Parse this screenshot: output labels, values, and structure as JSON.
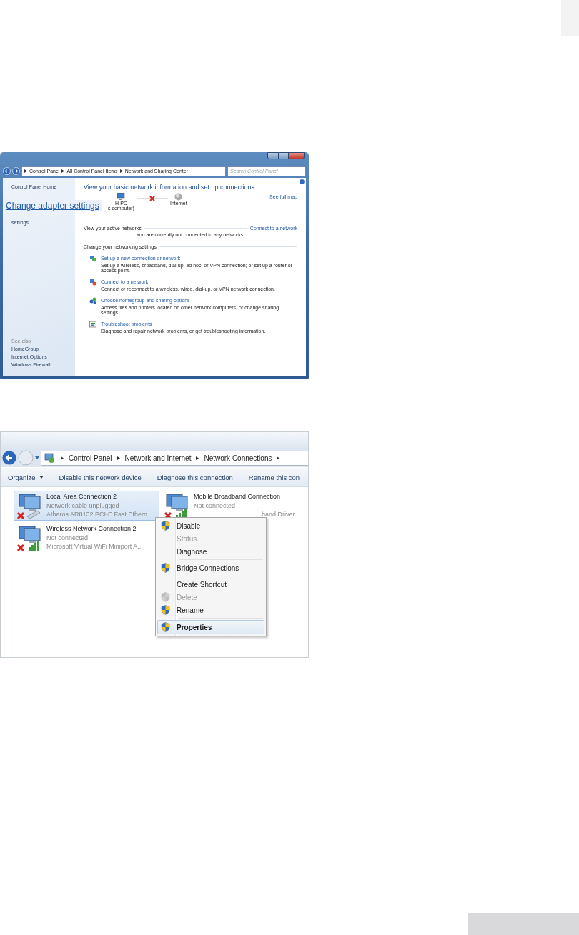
{
  "screenshot_1": {
    "address_path": [
      "Control Panel",
      "All Control Panel Items",
      "Network and Sharing Center"
    ],
    "search": {
      "placeholder": "Search Control Panel"
    },
    "sidebar": {
      "home": "Control Panel Home",
      "cut_text": "settings",
      "see_also": "See also",
      "links": [
        "HomeGroup",
        "Internet Options",
        "Windows Firewall"
      ]
    },
    "callout": "Change adapter settings",
    "heading": "View your basic network information and set up connections",
    "see_full_map": "See full map",
    "map": {
      "computer": "H-PC",
      "computer_sub": "s computer)",
      "internet": "Internet"
    },
    "active_networks": {
      "label": "View your active networks",
      "link": "Connect to a network",
      "message": "You are currently not connected to any networks."
    },
    "settings_label": "Change your networking settings",
    "tasks": [
      {
        "kind": "new",
        "title": "Set up a new connection or network",
        "description": "Set up a wireless, broadband, dial-up, ad hoc, or VPN connection; or set up a router or access point."
      },
      {
        "kind": "connect",
        "title": "Connect to a network",
        "description": "Connect or reconnect to a wireless, wired, dial-up, or VPN network connection."
      },
      {
        "kind": "homegroup",
        "title": "Choose homegroup and sharing options",
        "description": "Access files and printers located on other network computers, or change sharing settings."
      },
      {
        "kind": "troubleshoot",
        "title": "Troubleshoot problems",
        "description": "Diagnose and repair network problems, or get troubleshooting information."
      }
    ]
  },
  "screenshot_2": {
    "address_path": [
      "Control Panel",
      "Network and Internet",
      "Network Connections"
    ],
    "toolbar": [
      {
        "label": "Organize",
        "dropdown": true
      },
      {
        "label": "Disable this network device",
        "dropdown": false
      },
      {
        "label": "Diagnose this connection",
        "dropdown": false
      },
      {
        "label": "Rename this con",
        "dropdown": false
      }
    ],
    "connections": [
      {
        "kind": "wired",
        "name": "Local Area Connection 2",
        "status": "Network cable unplugged",
        "device": "Atheros AR8132 PCI-E Fast Ethern...",
        "selected": true
      },
      {
        "kind": "mobile",
        "name": "Mobile Broadband Connection",
        "status": "Not connected",
        "device": "band Driver",
        "selected": false
      },
      {
        "kind": "wireless",
        "name": "Wireless Network Connection 2",
        "status": "Not connected",
        "device": "Microsoft Virtual WiFi Miniport A...",
        "selected": false
      }
    ],
    "context_menu": [
      [
        {
          "label": "Disable",
          "shield": true,
          "disabled": false,
          "selected": false
        },
        {
          "label": "Status",
          "shield": false,
          "disabled": true,
          "selected": false
        },
        {
          "label": "Diagnose",
          "shield": false,
          "disabled": false,
          "selected": false
        }
      ],
      [
        {
          "label": "Bridge Connections",
          "shield": true,
          "disabled": false,
          "selected": false
        }
      ],
      [
        {
          "label": "Create Shortcut",
          "shield": false,
          "disabled": false,
          "selected": false
        },
        {
          "label": "Delete",
          "shield": true,
          "disabled": true,
          "selected": false
        },
        {
          "label": "Rename",
          "shield": true,
          "disabled": false,
          "selected": false
        }
      ],
      [
        {
          "label": "Properties",
          "shield": true,
          "disabled": false,
          "selected": true
        }
      ]
    ]
  }
}
